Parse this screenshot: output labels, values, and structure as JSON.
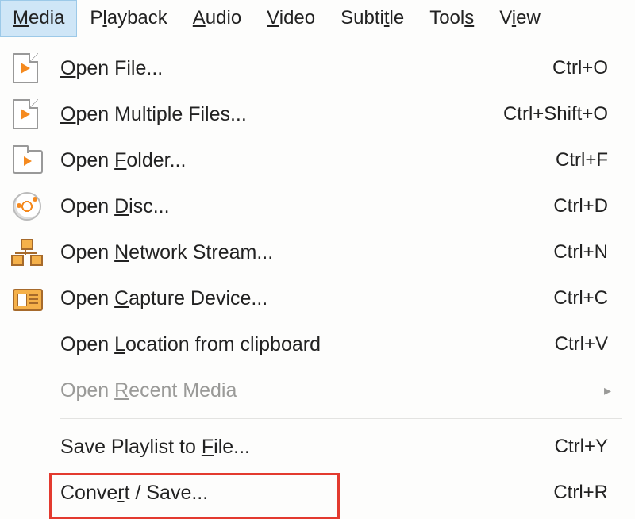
{
  "menubar": {
    "items": [
      {
        "pre": "",
        "hot": "M",
        "post": "edia",
        "active": true
      },
      {
        "pre": "P",
        "hot": "l",
        "post": "ayback",
        "active": false
      },
      {
        "pre": "",
        "hot": "A",
        "post": "udio",
        "active": false
      },
      {
        "pre": "",
        "hot": "V",
        "post": "ideo",
        "active": false
      },
      {
        "pre": "Subti",
        "hot": "t",
        "post": "le",
        "active": false
      },
      {
        "pre": "Tool",
        "hot": "s",
        "post": "",
        "active": false
      },
      {
        "pre": "V",
        "hot": "i",
        "post": "ew",
        "active": false
      }
    ]
  },
  "dropdown": {
    "items": [
      {
        "icon": "file",
        "pre": "",
        "hot": "O",
        "post": "pen File...",
        "shortcut": "Ctrl+O",
        "type": "item"
      },
      {
        "icon": "file",
        "pre": "",
        "hot": "O",
        "post": "pen Multiple Files...",
        "shortcut": "Ctrl+Shift+O",
        "type": "item"
      },
      {
        "icon": "folder",
        "pre": "Open ",
        "hot": "F",
        "post": "older...",
        "shortcut": "Ctrl+F",
        "type": "item"
      },
      {
        "icon": "disc",
        "pre": "Open ",
        "hot": "D",
        "post": "isc...",
        "shortcut": "Ctrl+D",
        "type": "item"
      },
      {
        "icon": "net",
        "pre": "Open ",
        "hot": "N",
        "post": "etwork Stream...",
        "shortcut": "Ctrl+N",
        "type": "item"
      },
      {
        "icon": "card",
        "pre": "Open ",
        "hot": "C",
        "post": "apture Device...",
        "shortcut": "Ctrl+C",
        "type": "item"
      },
      {
        "icon": "",
        "pre": "Open ",
        "hot": "L",
        "post": "ocation from clipboard",
        "shortcut": "Ctrl+V",
        "type": "item"
      },
      {
        "icon": "",
        "pre": "Open ",
        "hot": "R",
        "post": "ecent Media",
        "shortcut": "",
        "type": "submenu",
        "disabled": true
      },
      {
        "type": "sep"
      },
      {
        "icon": "",
        "pre": "Save Playlist to ",
        "hot": "F",
        "post": "ile...",
        "shortcut": "Ctrl+Y",
        "type": "item"
      },
      {
        "icon": "",
        "pre": "Conve",
        "hot": "r",
        "post": "t / Save...",
        "shortcut": "Ctrl+R",
        "type": "item",
        "highlighted": true
      }
    ]
  }
}
